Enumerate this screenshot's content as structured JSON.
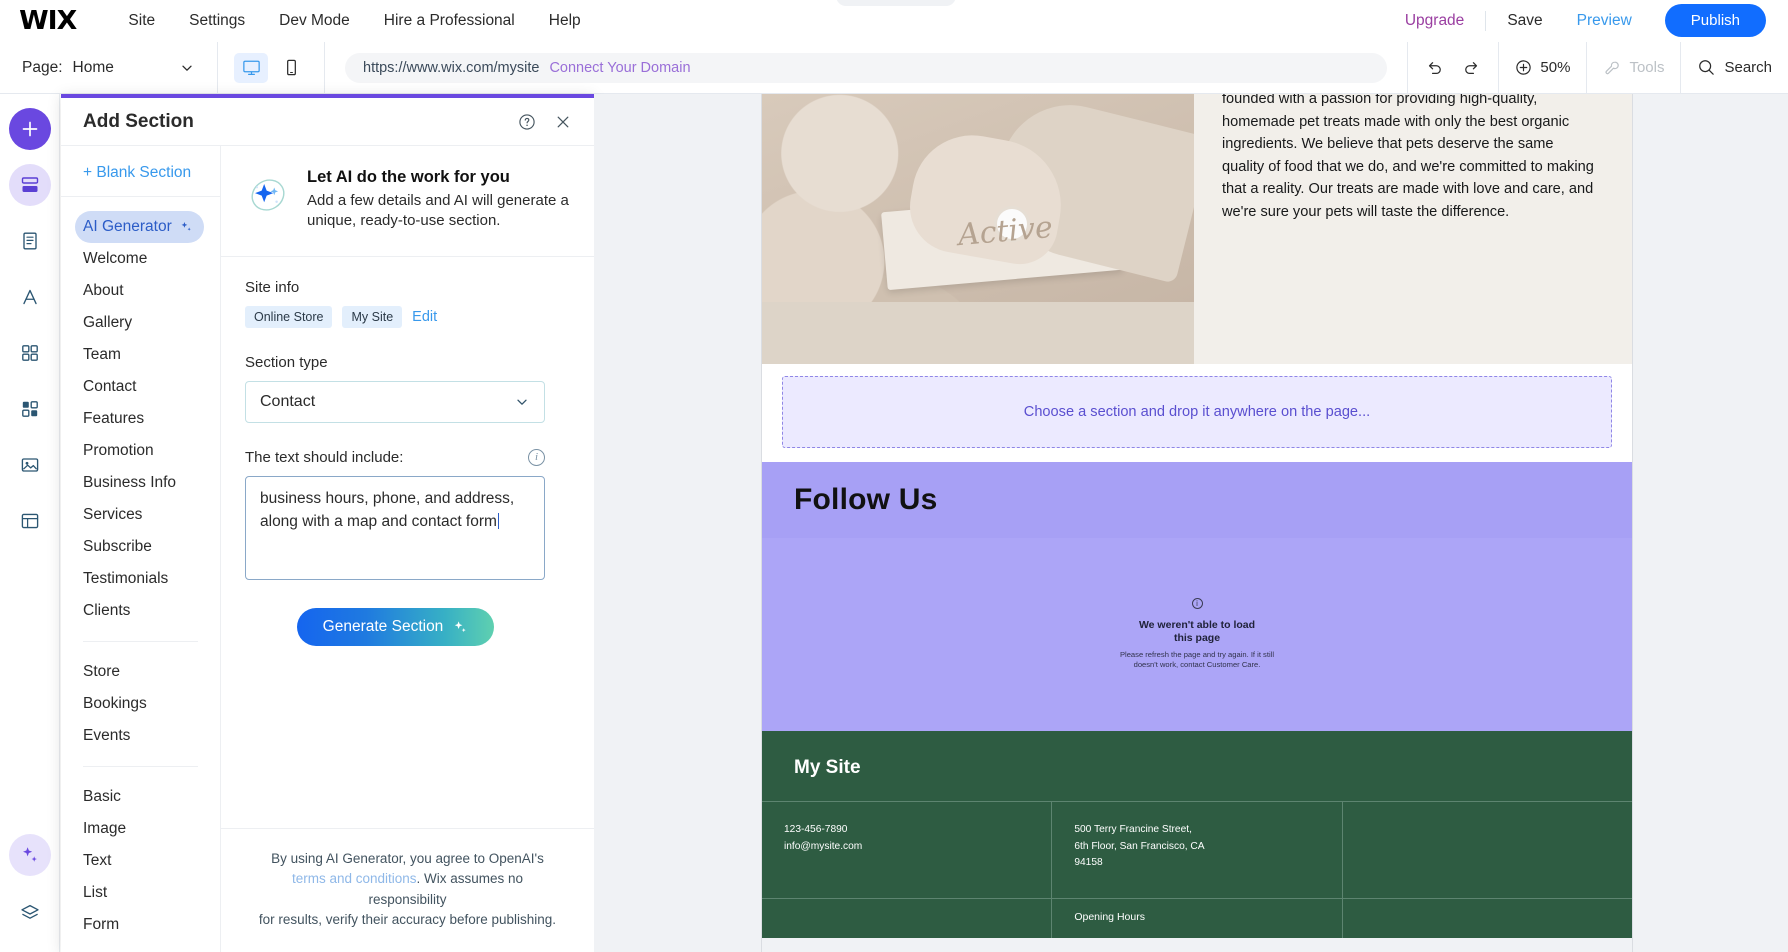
{
  "topbar": {
    "logo": "WIX",
    "menu": [
      "Site",
      "Settings",
      "Dev Mode",
      "Hire a Professional",
      "Help"
    ],
    "upgrade": "Upgrade",
    "save": "Save",
    "preview": "Preview",
    "publish": "Publish"
  },
  "secondbar": {
    "page_label": "Page:",
    "page_value": "Home",
    "url": "https://www.wix.com/mysite",
    "connect_domain": "Connect Your Domain",
    "zoom": "50%",
    "tools": "Tools",
    "search": "Search"
  },
  "panel": {
    "title": "Add Section",
    "blank_section": "+ Blank Section",
    "categories": [
      {
        "label": "AI Generator",
        "active": true
      },
      {
        "label": "Welcome",
        "active": false
      },
      {
        "label": "About",
        "active": false
      },
      {
        "label": "Gallery",
        "active": false
      },
      {
        "label": "Team",
        "active": false
      },
      {
        "label": "Contact",
        "active": false
      },
      {
        "label": "Features",
        "active": false
      },
      {
        "label": "Promotion",
        "active": false
      },
      {
        "label": "Business Info",
        "active": false
      },
      {
        "label": "Services",
        "active": false
      },
      {
        "label": "Subscribe",
        "active": false
      },
      {
        "label": "Testimonials",
        "active": false
      },
      {
        "label": "Clients",
        "active": false
      }
    ],
    "categories_group2": [
      {
        "label": "Store"
      },
      {
        "label": "Bookings"
      },
      {
        "label": "Events"
      }
    ],
    "categories_group3": [
      {
        "label": "Basic"
      },
      {
        "label": "Image"
      },
      {
        "label": "Text"
      },
      {
        "label": "List"
      },
      {
        "label": "Form"
      }
    ],
    "hero": {
      "title": "Let AI do the work for you",
      "subtitle": "Add a few details and AI will generate a unique, ready-to-use section."
    },
    "site_info": {
      "label": "Site info",
      "chips": [
        "Online Store",
        "My Site"
      ],
      "edit": "Edit"
    },
    "section_type": {
      "label": "Section type",
      "value": "Contact"
    },
    "prompt": {
      "label": "The text should include:",
      "value": "business hours, phone, and address, along with a map and contact form"
    },
    "generate_button": "Generate Section",
    "footer": {
      "line1": "By using AI Generator, you agree to OpenAI's",
      "link": "terms and conditions",
      "line2": ". Wix assumes no responsibility",
      "line3": "for results, verify their accuracy before publishing."
    }
  },
  "canvas": {
    "about_text": "founded with a passion for providing high-quality, homemade pet treats made with only the best organic ingredients. We believe that pets deserve the same quality of food that we do, and we're committed to making that a reality. Our treats are made with love and care, and we're sure your pets will taste the difference.",
    "about_image_script": "Active",
    "drop_zone": "Choose a section and drop it anywhere on the page...",
    "follow_us": "Follow Us",
    "error": {
      "title": "We weren't able to load this page",
      "subtitle": "Please refresh the page and try again. If it still doesn't work, contact Customer Care."
    },
    "footer": {
      "site_name": "My Site",
      "phone": "123-456-7890",
      "email": "info@mysite.com",
      "address_line1": "500 Terry Francine Street,",
      "address_line2": "6th Floor, San Francisco, CA",
      "address_line3": "94158",
      "hours_heading": "Opening Hours"
    }
  },
  "icons": {
    "add": "plus-icon",
    "sections": "sections-icon",
    "pages": "pages-icon",
    "design": "design-icon",
    "apps": "apps-icon",
    "marketplace": "marketplace-icon",
    "media": "media-icon",
    "content": "content-manager-icon",
    "ai": "ai-sparkle-icon",
    "layers": "layers-icon",
    "help": "help-icon",
    "close": "close-icon",
    "undo": "undo-icon",
    "redo": "redo-icon",
    "zoom": "zoom-icon",
    "tools": "tools-icon",
    "search": "search-icon",
    "desktop": "desktop-icon",
    "mobile": "mobile-icon",
    "chevron_down": "chevron-down-icon"
  },
  "colors": {
    "brand_purple": "#6a48e0",
    "publish_blue": "#116dff",
    "upgrade": "#9a3ea1",
    "preview": "#3899ec",
    "follow_bg": "#a7a0f5",
    "footer_green": "#2e5c42"
  }
}
